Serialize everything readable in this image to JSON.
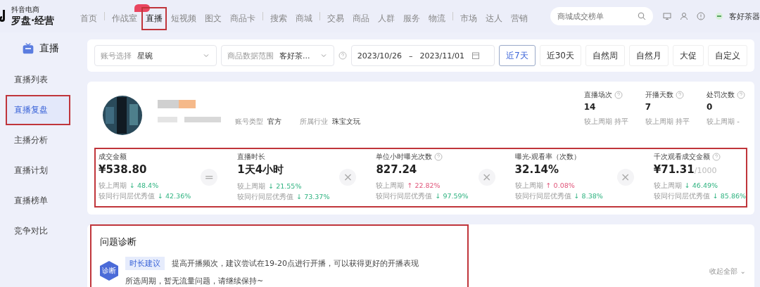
{
  "logo": {
    "small": "抖音电商",
    "main": "罗盘·经营"
  },
  "nav": [
    {
      "label": "首页",
      "selected": false,
      "sep_after": true
    },
    {
      "label": "作战室",
      "selected": false,
      "sep_after": false
    },
    {
      "label": "直播",
      "selected": true,
      "sep_after": false,
      "badge": true
    },
    {
      "label": "短视频",
      "selected": false,
      "sep_after": false
    },
    {
      "label": "图文",
      "selected": false,
      "sep_after": false
    },
    {
      "label": "商品卡",
      "selected": false,
      "sep_after": true
    },
    {
      "label": "搜索",
      "selected": false,
      "sep_after": false
    },
    {
      "label": "商城",
      "selected": false,
      "sep_after": true
    },
    {
      "label": "交易",
      "selected": false,
      "sep_after": false
    },
    {
      "label": "商品",
      "selected": false,
      "sep_after": false
    },
    {
      "label": "人群",
      "selected": false,
      "sep_after": false
    },
    {
      "label": "服务",
      "selected": false,
      "sep_after": false
    },
    {
      "label": "物流",
      "selected": false,
      "sep_after": true
    },
    {
      "label": "市场",
      "selected": false,
      "sep_after": false
    },
    {
      "label": "达人",
      "selected": false,
      "sep_after": false
    },
    {
      "label": "营销",
      "selected": false,
      "sep_after": false
    }
  ],
  "search": {
    "placeholder": "商城成交榜单"
  },
  "shop_name": "客好茶器",
  "sidebar": {
    "title": "直播",
    "items": [
      {
        "label": "直播列表",
        "selected": false
      },
      {
        "label": "直播复盘",
        "selected": true
      },
      {
        "label": "主播分析",
        "selected": false
      },
      {
        "label": "直播计划",
        "selected": false
      },
      {
        "label": "直播榜单",
        "selected": false
      },
      {
        "label": "竞争对比",
        "selected": false
      }
    ]
  },
  "filters": [
    {
      "label": "账号选择",
      "value": "星碗"
    },
    {
      "label": "商品数据范围",
      "value": "客好茶..."
    }
  ],
  "date_range": {
    "start": "2023/10/26",
    "separator": "–",
    "end": "2023/11/01"
  },
  "periods": [
    {
      "label": "近7天",
      "selected": true
    },
    {
      "label": "近30天",
      "selected": false
    },
    {
      "label": "自然周",
      "selected": false
    },
    {
      "label": "自然月",
      "selected": false
    },
    {
      "label": "大促",
      "selected": false
    },
    {
      "label": "自定义",
      "selected": false
    }
  ],
  "account": {
    "type_label": "账号类型",
    "type": "官方",
    "industry_label": "所属行业",
    "industry": "珠宝文玩"
  },
  "counters": [
    {
      "label": "直播场次",
      "value": "14",
      "compare": "较上周期",
      "change": "持平"
    },
    {
      "label": "开播天数",
      "value": "7",
      "compare": "较上周期",
      "change": "持平"
    },
    {
      "label": "处罚次数",
      "value": "0",
      "compare": "较上周期",
      "change": "-"
    }
  ],
  "metrics": [
    {
      "label": "成交金额",
      "help": false,
      "value": "¥538.80",
      "op": "=",
      "prev_label": "较上周期",
      "prev": "↓ 48.4%",
      "prev_up": false,
      "peer_label": "较同行同层优秀值",
      "peer": "↓ 42.36%",
      "peer_up": false
    },
    {
      "label": "直播时长",
      "help": false,
      "value": "1天4小时",
      "op": "×",
      "prev_label": "较上周期",
      "prev": "↓ 21.55%",
      "prev_up": false,
      "peer_label": "较同行同层优秀值",
      "peer": "↓ 73.37%",
      "peer_up": false
    },
    {
      "label": "单位小时曝光次数",
      "help": true,
      "value": "827.24",
      "op": "×",
      "prev_label": "较上周期",
      "prev": "↑ 22.82%",
      "prev_up": true,
      "peer_label": "较同行同层优秀值",
      "peer": "↓ 97.59%",
      "peer_up": false
    },
    {
      "label": "曝光-观看率（次数）",
      "help": false,
      "value": "32.14%",
      "op": "×",
      "prev_label": "较上周期",
      "prev": "↑ 0.08%",
      "prev_up": true,
      "peer_label": "较同行同层优秀值",
      "peer": "↓ 8.38%",
      "peer_up": false
    },
    {
      "label": "千次观看成交金额",
      "help": true,
      "value": "¥71.31",
      "unit": "/1000",
      "prev_label": "较上周期",
      "prev": "↓ 46.49%",
      "prev_up": false,
      "peer_label": "较同行同层优秀值",
      "peer": "↓ 85.86%",
      "peer_up": false
    }
  ],
  "diagnosis": {
    "title": "问题诊断",
    "icon_label": "诊断",
    "tag": "时长建议",
    "text": "提高开播频次，建议尝试在19-20点进行开播，可以获得更好的开播表现",
    "text2": "所选周期，暂无流量问题，请继续保持~",
    "collapse": "收起全部 ⌄"
  }
}
